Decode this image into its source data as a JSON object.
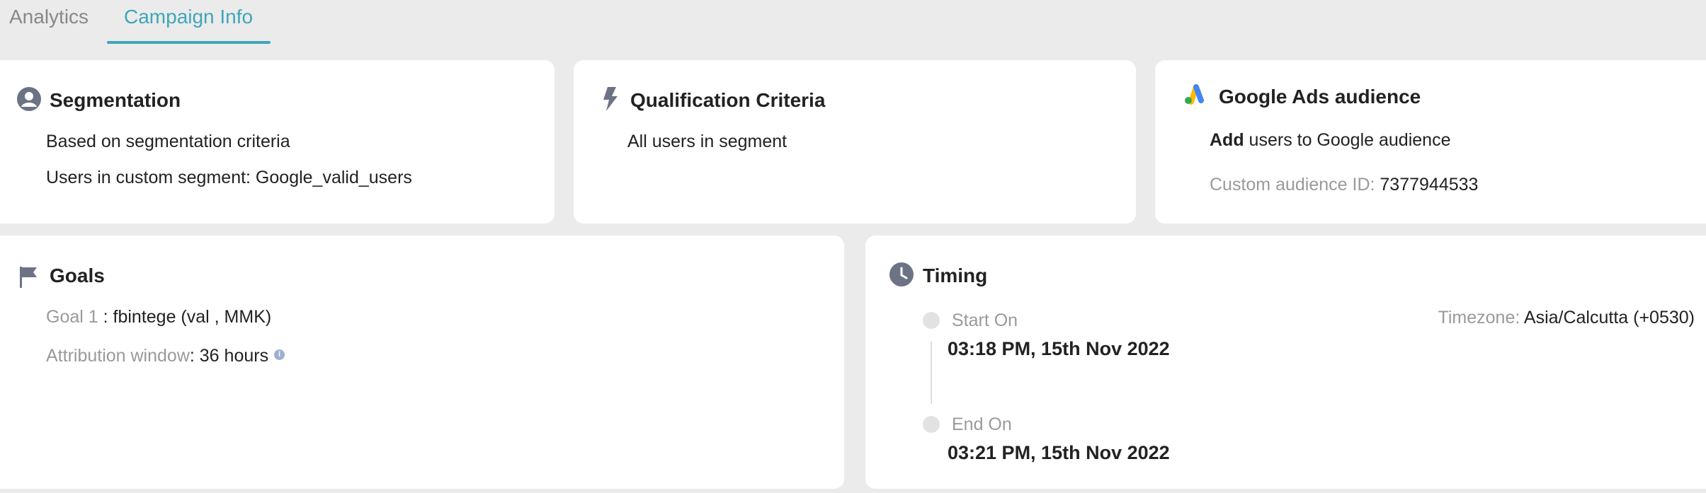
{
  "tabs": {
    "analytics": "Analytics",
    "campaign_info": "Campaign Info"
  },
  "segmentation": {
    "title": "Segmentation",
    "line1": "Based on segmentation criteria",
    "line2": "Users in custom segment: Google_valid_users"
  },
  "qualification": {
    "title": "Qualification Criteria",
    "line1": "All users in segment"
  },
  "google_ads": {
    "title": "Google Ads audience",
    "action": "Add",
    "action_rest": " users to Google audience",
    "audience_label": "Custom audience ID: ",
    "audience_id": "7377944533"
  },
  "goals": {
    "title": "Goals",
    "goal_label": "Goal 1",
    "goal_value": " : fbintege (val , MMK)",
    "attribution_label": "Attribution window",
    "attribution_value": ": 36 hours"
  },
  "timing": {
    "title": "Timing",
    "start_label": "Start On",
    "start_value": "03:18 PM, 15th Nov 2022",
    "end_label": "End On",
    "end_value": "03:21 PM, 15th Nov 2022",
    "timezone_label": "Timezone: ",
    "timezone_value": "Asia/Calcutta (+0530)"
  },
  "colors": {
    "accent": "#3fa6b8",
    "icon": "#6b7385",
    "muted": "#9a9a9a"
  },
  "icons": {
    "segmentation": "user-circle-icon",
    "qualification": "lightning-icon",
    "google_ads": "google-ads-icon",
    "goals": "flag-icon",
    "timing": "clock-icon",
    "info": "info-icon"
  }
}
